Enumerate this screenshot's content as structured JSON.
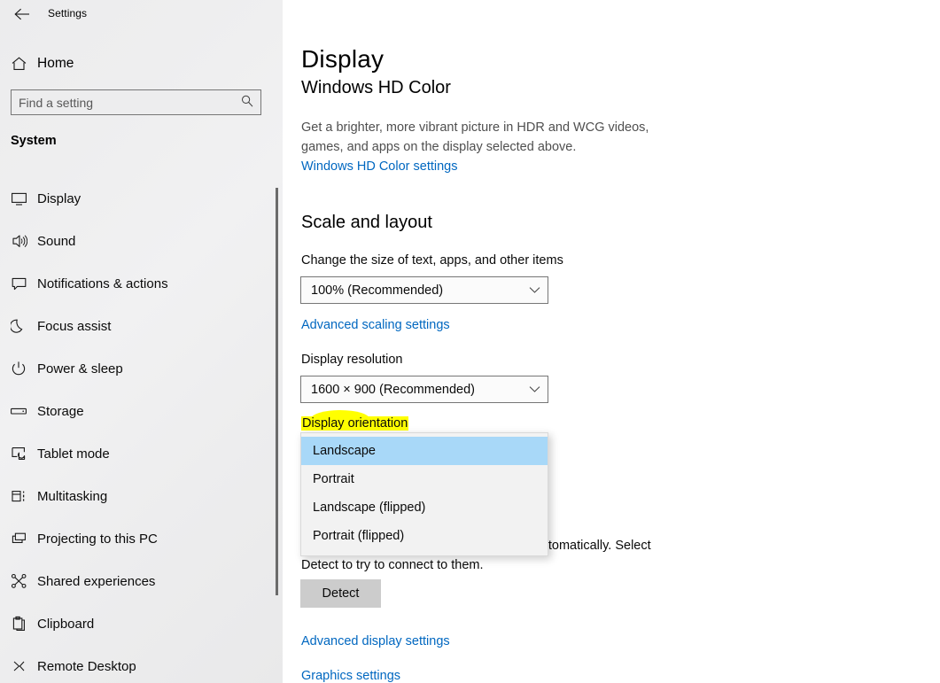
{
  "window": {
    "title": "Settings",
    "back_icon": "back-arrow-icon",
    "controls": [
      {
        "name": "minimize-button",
        "glyph": "minimize-icon"
      },
      {
        "name": "maximize-button",
        "glyph": "maximize-icon"
      },
      {
        "name": "close-button",
        "glyph": "close-icon"
      }
    ]
  },
  "sidebar": {
    "home_label": "Home",
    "home_icon": "home-icon",
    "search": {
      "placeholder": "Find a setting",
      "value": "",
      "icon": "search-icon"
    },
    "section_heading": "System",
    "items": [
      {
        "label": "Display",
        "icon": "monitor-icon"
      },
      {
        "label": "Sound",
        "icon": "speaker-icon"
      },
      {
        "label": "Notifications & actions",
        "icon": "chat-bubble-icon"
      },
      {
        "label": "Focus assist",
        "icon": "moon-icon"
      },
      {
        "label": "Power & sleep",
        "icon": "power-icon"
      },
      {
        "label": "Storage",
        "icon": "drive-icon"
      },
      {
        "label": "Tablet mode",
        "icon": "tablet-touch-icon"
      },
      {
        "label": "Multitasking",
        "icon": "multitasking-icon"
      },
      {
        "label": "Projecting to this PC",
        "icon": "projecting-icon"
      },
      {
        "label": "Shared experiences",
        "icon": "share-nodes-icon"
      },
      {
        "label": "Clipboard",
        "icon": "clipboard-icon"
      },
      {
        "label": "Remote Desktop",
        "icon": "remote-desktop-icon"
      }
    ]
  },
  "main": {
    "page_title": "Display",
    "hd_color": {
      "heading": "Windows HD Color",
      "description": "Get a brighter, more vibrant picture in HDR and WCG videos, games, and apps on the display selected above.",
      "link": "Windows HD Color settings"
    },
    "scale_and_layout": {
      "heading": "Scale and layout",
      "scale_label": "Change the size of text, apps, and other items",
      "scale_value": "100% (Recommended)",
      "advanced_scaling_link": "Advanced scaling settings",
      "resolution_label": "Display resolution",
      "resolution_value": "1600 × 900 (Recommended)",
      "orientation_label": "Display orientation",
      "orientation_highlight_color": "#ffff00"
    },
    "orientation_dropdown": {
      "open": true,
      "selected": "Landscape",
      "selected_color": "#a8d8f8",
      "options": [
        "Landscape",
        "Portrait",
        "Landscape (flipped)",
        "Portrait (flipped)"
      ]
    },
    "multiple_displays": {
      "text": "Older displays might not always connect automatically. Select Detect to try to connect to them.",
      "detect_button": "Detect"
    },
    "advanced_display_link": "Advanced display settings",
    "graphics_link": "Graphics settings"
  },
  "colors": {
    "accent_link": "#0067c0",
    "highlight_yellow": "#ffff00",
    "dropdown_selection": "#a8d8f8",
    "button_gray": "#cccccc"
  }
}
